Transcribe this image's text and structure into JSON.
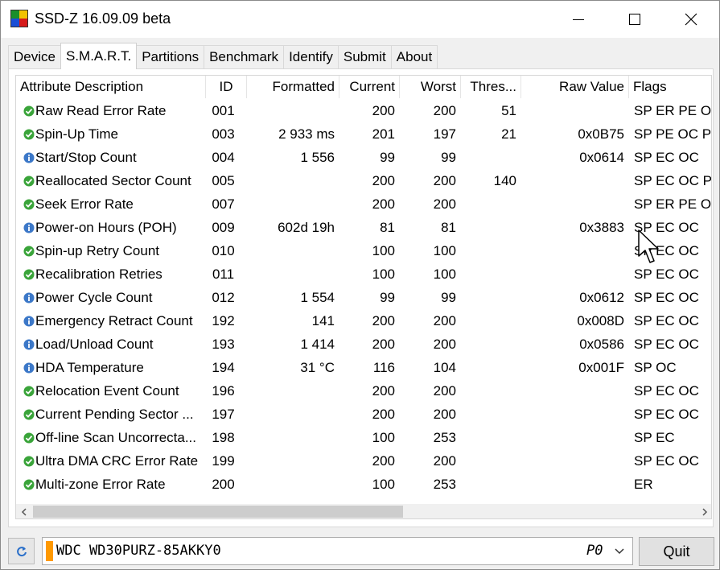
{
  "window": {
    "title": "SSD-Z 16.09.09 beta"
  },
  "tabs": [
    {
      "label": "Device",
      "active": false
    },
    {
      "label": "S.M.A.R.T.",
      "active": true
    },
    {
      "label": "Partitions",
      "active": false
    },
    {
      "label": "Benchmark",
      "active": false
    },
    {
      "label": "Identify",
      "active": false
    },
    {
      "label": "Submit",
      "active": false
    },
    {
      "label": "About",
      "active": false
    }
  ],
  "table": {
    "headers": {
      "attribute": "Attribute Description",
      "id": "ID",
      "formatted": "Formatted",
      "current": "Current",
      "worst": "Worst",
      "threshold": "Thres...",
      "raw": "Raw Value",
      "flags": "Flags"
    },
    "rows": [
      {
        "status": "ok",
        "name": "Raw Read Error Rate",
        "id": "001",
        "formatted": "",
        "current": "200",
        "worst": "200",
        "threshold": "51",
        "raw": "",
        "flags": "SP ER PE OC"
      },
      {
        "status": "ok",
        "name": "Spin-Up Time",
        "id": "003",
        "formatted": "2 933 ms",
        "current": "201",
        "worst": "197",
        "threshold": "21",
        "raw": "0x0B75",
        "flags": "SP PE OC PW"
      },
      {
        "status": "info",
        "name": "Start/Stop Count",
        "id": "004",
        "formatted": "1 556",
        "current": "99",
        "worst": "99",
        "threshold": "",
        "raw": "0x0614",
        "flags": "SP EC OC"
      },
      {
        "status": "ok",
        "name": "Reallocated Sector Count",
        "id": "005",
        "formatted": "",
        "current": "200",
        "worst": "200",
        "threshold": "140",
        "raw": "",
        "flags": "SP EC OC PW"
      },
      {
        "status": "ok",
        "name": "Seek Error Rate",
        "id": "007",
        "formatted": "",
        "current": "200",
        "worst": "200",
        "threshold": "",
        "raw": "",
        "flags": "SP ER PE OC"
      },
      {
        "status": "info",
        "name": "Power-on Hours (POH)",
        "id": "009",
        "formatted": "602d 19h",
        "current": "81",
        "worst": "81",
        "threshold": "",
        "raw": "0x3883",
        "flags": "SP EC OC"
      },
      {
        "status": "ok",
        "name": "Spin-up Retry Count",
        "id": "010",
        "formatted": "",
        "current": "100",
        "worst": "100",
        "threshold": "",
        "raw": "",
        "flags": "SP EC OC"
      },
      {
        "status": "ok",
        "name": "Recalibration Retries",
        "id": "011",
        "formatted": "",
        "current": "100",
        "worst": "100",
        "threshold": "",
        "raw": "",
        "flags": "SP EC OC"
      },
      {
        "status": "info",
        "name": "Power Cycle Count",
        "id": "012",
        "formatted": "1 554",
        "current": "99",
        "worst": "99",
        "threshold": "",
        "raw": "0x0612",
        "flags": "SP EC OC"
      },
      {
        "status": "info",
        "name": "Emergency Retract Count",
        "id": "192",
        "formatted": "141",
        "current": "200",
        "worst": "200",
        "threshold": "",
        "raw": "0x008D",
        "flags": "SP EC OC"
      },
      {
        "status": "info",
        "name": "Load/Unload Count",
        "id": "193",
        "formatted": "1 414",
        "current": "200",
        "worst": "200",
        "threshold": "",
        "raw": "0x0586",
        "flags": "SP EC OC"
      },
      {
        "status": "info",
        "name": "HDA Temperature",
        "id": "194",
        "formatted": "31 °C",
        "current": "116",
        "worst": "104",
        "threshold": "",
        "raw": "0x001F",
        "flags": "SP OC"
      },
      {
        "status": "ok",
        "name": "Relocation Event Count",
        "id": "196",
        "formatted": "",
        "current": "200",
        "worst": "200",
        "threshold": "",
        "raw": "",
        "flags": "SP EC OC"
      },
      {
        "status": "ok",
        "name": "Current Pending Sector ...",
        "id": "197",
        "formatted": "",
        "current": "200",
        "worst": "200",
        "threshold": "",
        "raw": "",
        "flags": "SP EC OC"
      },
      {
        "status": "ok",
        "name": "Off-line Scan Uncorrecta...",
        "id": "198",
        "formatted": "",
        "current": "100",
        "worst": "253",
        "threshold": "",
        "raw": "",
        "flags": "SP EC"
      },
      {
        "status": "ok",
        "name": "Ultra DMA CRC Error Rate",
        "id": "199",
        "formatted": "",
        "current": "200",
        "worst": "200",
        "threshold": "",
        "raw": "",
        "flags": "SP EC OC"
      },
      {
        "status": "ok",
        "name": "Multi-zone Error Rate",
        "id": "200",
        "formatted": "",
        "current": "100",
        "worst": "253",
        "threshold": "",
        "raw": "",
        "flags": "ER"
      }
    ]
  },
  "drive": {
    "name": "WDC WD30PURZ-85AKKY0",
    "port": "P0"
  },
  "buttons": {
    "quit": "Quit"
  },
  "colors": {
    "ok": "#3aa43a",
    "info": "#3c78c8",
    "drive_accent": "#ff9900"
  }
}
